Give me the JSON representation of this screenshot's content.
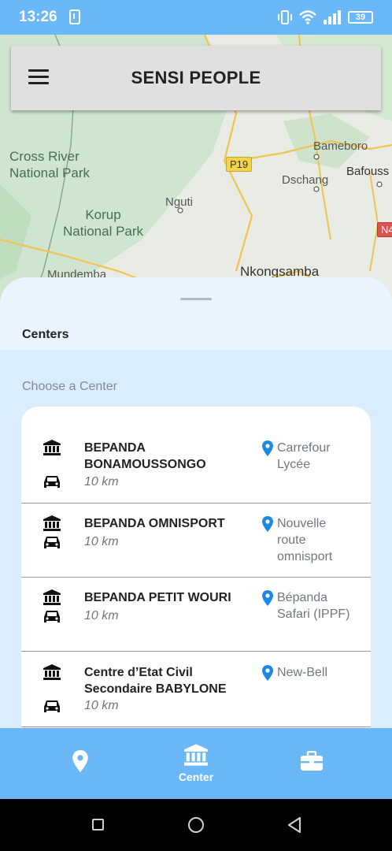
{
  "status_bar": {
    "time": "13:26",
    "battery": "39",
    "icons": [
      "download-icon",
      "vibrate-icon",
      "wifi-icon",
      "signal-icon",
      "battery-icon"
    ]
  },
  "map": {
    "labels": {
      "cross_river": "Cross River\nNational Park",
      "korup": "Korup\nNational Park",
      "nguti": "Nguti",
      "mundemba": "Mundemba",
      "nkongsamba": "Nkongsamba",
      "bameboro": "Bameboro",
      "dschang": "Dschang",
      "bafoussam": "Bafouss",
      "p19": "P19",
      "n4": "N4"
    }
  },
  "app_bar": {
    "title": "SENSI PEOPLE",
    "menu_icon": "menu-icon"
  },
  "sheet": {
    "title": "Centers",
    "choose_label": "Choose a Center"
  },
  "centers": [
    {
      "name": "BEPANDA BONAMOUSSONGO",
      "distance": "10 km",
      "location": "Carrefour Lycée"
    },
    {
      "name": "BEPANDA OMNISPORT",
      "distance": "10 km",
      "location": "Nouvelle route omnisport"
    },
    {
      "name": "BEPANDA PETIT WOURI",
      "distance": "10 km",
      "location": "Bépanda Safari (IPPF)"
    },
    {
      "name": "Centre d’Etat Civil Secondaire BABYLONE",
      "distance": "10 km",
      "location": "New-Bell"
    }
  ],
  "bottom_nav": {
    "items": [
      {
        "icon": "map-pin-icon",
        "label": ""
      },
      {
        "icon": "bank-icon",
        "label": "Center"
      },
      {
        "icon": "briefcase-icon",
        "label": ""
      }
    ]
  },
  "colors": {
    "accent": "#6ab8f7",
    "pin": "#1e88e5",
    "sheet_bg": "#dbecfd"
  }
}
